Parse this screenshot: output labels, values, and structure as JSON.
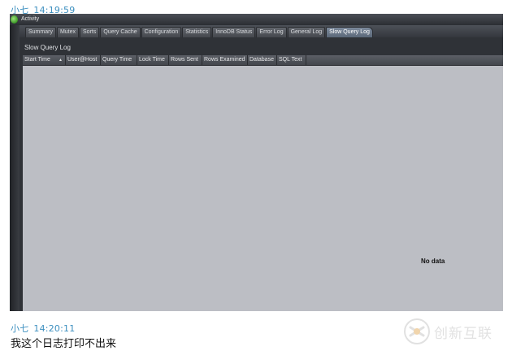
{
  "messages": [
    {
      "sender": "小七",
      "time": "14:19:59"
    },
    {
      "sender": "小七",
      "time": "14:20:11",
      "text": "我这个日志打印不出来"
    }
  ],
  "screenshot": {
    "window_title": "Activity",
    "tabs": [
      {
        "label": "Summary"
      },
      {
        "label": "Mutex"
      },
      {
        "label": "Sorts"
      },
      {
        "label": "Query Cache"
      },
      {
        "label": "Configuration"
      },
      {
        "label": "Statistics"
      },
      {
        "label": "InnoDB Status"
      },
      {
        "label": "Error Log"
      },
      {
        "label": "General Log"
      },
      {
        "label": "Slow Query Log",
        "active": true
      }
    ],
    "panel_title": "Slow Query Log",
    "columns": [
      "Start Time",
      "User@Host",
      "Query Time",
      "Lock Time",
      "Rows Sent",
      "Rows Examined",
      "Database",
      "SQL Text"
    ],
    "sort_column": "Start Time",
    "sort_icon": "sort-ascending-icon",
    "empty_message": "No data"
  },
  "watermark": {
    "brand": "创新互联"
  },
  "colors": {
    "sender_name": "#3c8fbf",
    "app_background": "#2f3237",
    "grid_body": "#bcbec4",
    "active_tab": "#6f7d8f"
  }
}
